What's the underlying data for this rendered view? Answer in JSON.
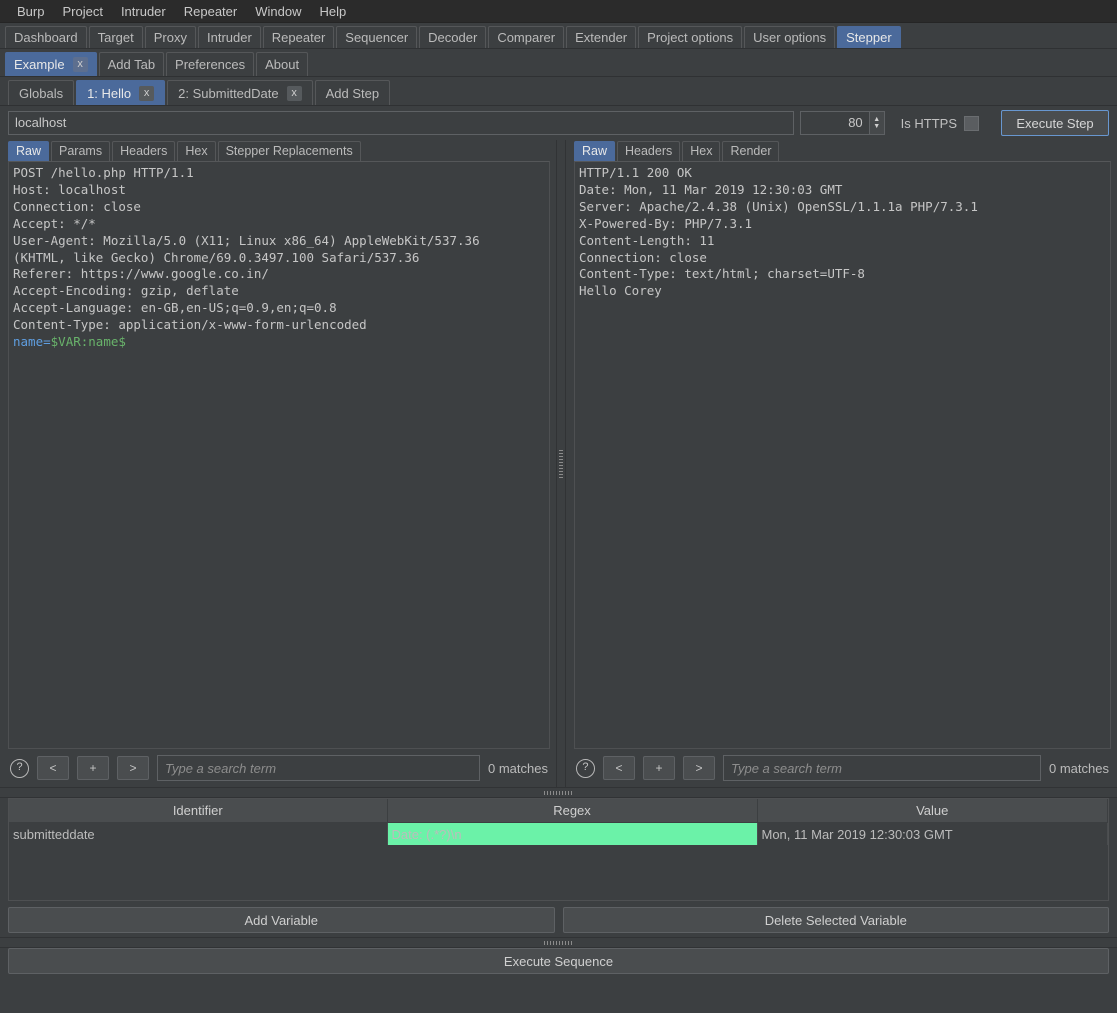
{
  "menubar": {
    "items": [
      "Burp",
      "Project",
      "Intruder",
      "Repeater",
      "Window",
      "Help"
    ]
  },
  "top_tabs": {
    "active": "Stepper",
    "items": [
      "Dashboard",
      "Target",
      "Proxy",
      "Intruder",
      "Repeater",
      "Sequencer",
      "Decoder",
      "Comparer",
      "Extender",
      "Project options",
      "User options",
      "Stepper"
    ]
  },
  "ext_tabs": {
    "active": "Example",
    "close_label": "x",
    "items": [
      {
        "label": "Example",
        "closable": true
      },
      {
        "label": "Add Tab",
        "closable": false
      },
      {
        "label": "Preferences",
        "closable": false
      },
      {
        "label": "About",
        "closable": false
      }
    ]
  },
  "step_tabs": {
    "active": "1: Hello",
    "close_label": "x",
    "items": [
      {
        "label": "Globals",
        "closable": false
      },
      {
        "label": "1: Hello",
        "closable": true
      },
      {
        "label": "2: SubmittedDate",
        "closable": true
      },
      {
        "label": "Add Step",
        "closable": false
      }
    ]
  },
  "urlbar": {
    "host": "localhost",
    "host_placeholder": "",
    "port": "80",
    "https_label": "Is HTTPS",
    "https_checked": false,
    "execute_label": "Execute Step"
  },
  "request": {
    "tabs": [
      "Raw",
      "Params",
      "Headers",
      "Hex",
      "Stepper Replacements"
    ],
    "active_tab": "Raw",
    "headers_text": "POST /hello.php HTTP/1.1\nHost: localhost\nConnection: close\nAccept: */*\nUser-Agent: Mozilla/5.0 (X11; Linux x86_64) AppleWebKit/537.36\n(KHTML, like Gecko) Chrome/69.0.3497.100 Safari/537.36\nReferer: https://www.google.co.in/\nAccept-Encoding: gzip, deflate\nAccept-Language: en-GB,en-US;q=0.9,en;q=0.8\nContent-Type: application/x-www-form-urlencoded",
    "body_key": "name=",
    "body_value": "$VAR:name$",
    "search": {
      "help_label": "?",
      "prev_label": "<",
      "add_label": "+",
      "next_label": ">",
      "placeholder": "Type a search term",
      "value": "",
      "matches": "0 matches"
    }
  },
  "response": {
    "tabs": [
      "Raw",
      "Headers",
      "Hex",
      "Render"
    ],
    "active_tab": "Raw",
    "headers_text": "HTTP/1.1 200 OK\nDate: Mon, 11 Mar 2019 12:30:03 GMT\nServer: Apache/2.4.38 (Unix) OpenSSL/1.1.1a PHP/7.3.1\nX-Powered-By: PHP/7.3.1\nContent-Length: 11\nConnection: close\nContent-Type: text/html; charset=UTF-8",
    "body_text": "Hello Corey",
    "search": {
      "help_label": "?",
      "prev_label": "<",
      "add_label": "+",
      "next_label": ">",
      "placeholder": "Type a search term",
      "value": "",
      "matches": "0 matches"
    }
  },
  "variables_table": {
    "columns": [
      "Identifier",
      "Regex",
      "Value"
    ],
    "rows": [
      {
        "identifier": "submitteddate",
        "regex": "Date: (.*?)\\n",
        "value": "Mon, 11 Mar 2019 12:30:03 GMT"
      }
    ]
  },
  "actions": {
    "add_variable": "Add Variable",
    "delete_selected_variable": "Delete Selected Variable",
    "execute_sequence": "Execute Sequence"
  },
  "colors": {
    "accent_tab": "#4b6a9b",
    "window_bg": "#3c3f41",
    "menubar_bg": "#2b2b2b",
    "highlight_green": "#6bf2a8",
    "focus_border": "#6897d0",
    "token_key": "#5f9ee0",
    "token_value": "#69b36b"
  }
}
